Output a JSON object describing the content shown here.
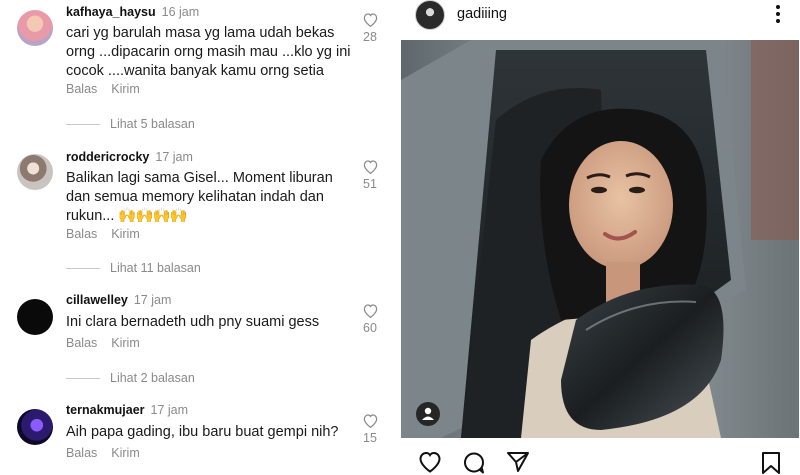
{
  "comments": [
    {
      "username": "kafhaya_haysu",
      "time": "16 jam",
      "text": "cari yg barulah masa yg lama udah bekas orng ...dipacarin orng masih mau ...klo yg ini cocok ....wanita banyak kamu orng setia",
      "reply_label": "Balas",
      "send_label": "Kirim",
      "likes": "28",
      "view_replies": "Lihat 5 balasan"
    },
    {
      "username": "roddericrocky",
      "time": "17 jam",
      "text": "Balikan lagi sama Gisel... Moment liburan dan semua memory kelihatan indah dan rukun...",
      "emoji": "🙌🙌🙌🙌",
      "reply_label": "Balas",
      "send_label": "Kirim",
      "likes": "51",
      "view_replies": "Lihat 11 balasan"
    },
    {
      "username": "cillawelley",
      "time": "17 jam",
      "text": "Ini clara bernadeth udh pny suami gess",
      "reply_label": "Balas",
      "send_label": "Kirim",
      "likes": "60",
      "view_replies": "Lihat 2 balasan"
    },
    {
      "username": "ternakmujaer",
      "time": "17 jam",
      "text": "Aih papa gading, ibu baru buat gempi nih?",
      "reply_label": "Balas",
      "send_label": "Kirim",
      "likes": "15"
    }
  ],
  "post": {
    "username": "gadiiing",
    "icons": {
      "more": "more-vertical-icon",
      "tag": "user-tag-icon",
      "like": "heart-icon",
      "comment": "comment-icon",
      "share": "send-icon",
      "save": "bookmark-icon"
    }
  }
}
